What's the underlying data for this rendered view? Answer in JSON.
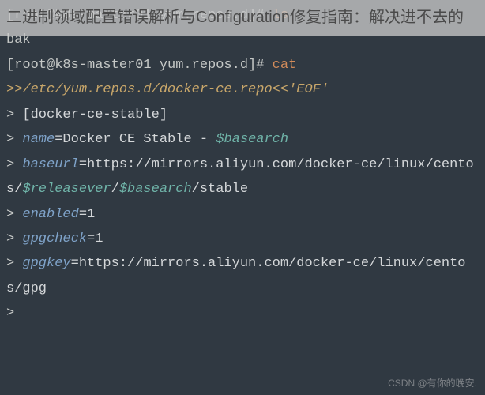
{
  "overlay": {
    "title": "二进制领域配置错误解析与Configuration修复指南：解决进不去的"
  },
  "terminal": {
    "line1_prompt": "[root@k8s-master01 yum.repos.d]# ",
    "line1_cmd": "ls",
    "line2_output": "bak",
    "line3_prompt": "[root@k8s-master01 yum.repos.d]# ",
    "line3_cmd": "cat ",
    "line4_redirect": ">>/etc/yum.repos.d/docker-ce.repo<<'EOF'",
    "line5_gt": "> ",
    "line5_text": "[docker-ce-stable]",
    "line6_gt": "> ",
    "line6_key": "name",
    "line6_text": "=Docker CE Stable - ",
    "line6_var": "$basearch",
    "line7_gt": "> ",
    "line7_key": "baseurl",
    "line7_text": "=https://mirrors.aliyun.com/docker-ce/linux/centos/",
    "line7_var1": "$releasever",
    "line7_sep": "/",
    "line7_var2": "$basearch",
    "line7_tail": "/stable",
    "line8_gt": "> ",
    "line8_key": "enabled",
    "line8_text": "=1",
    "line9_gt": "> ",
    "line9_key": "gpgcheck",
    "line9_text": "=1",
    "line10_gt": "> ",
    "line10_key": "gpgkey",
    "line10_text": "=https://mirrors.aliyun.com/docker-ce/linux/centos/gpg",
    "line11_gt": ">"
  },
  "watermark": "CSDN @有你的晚安."
}
